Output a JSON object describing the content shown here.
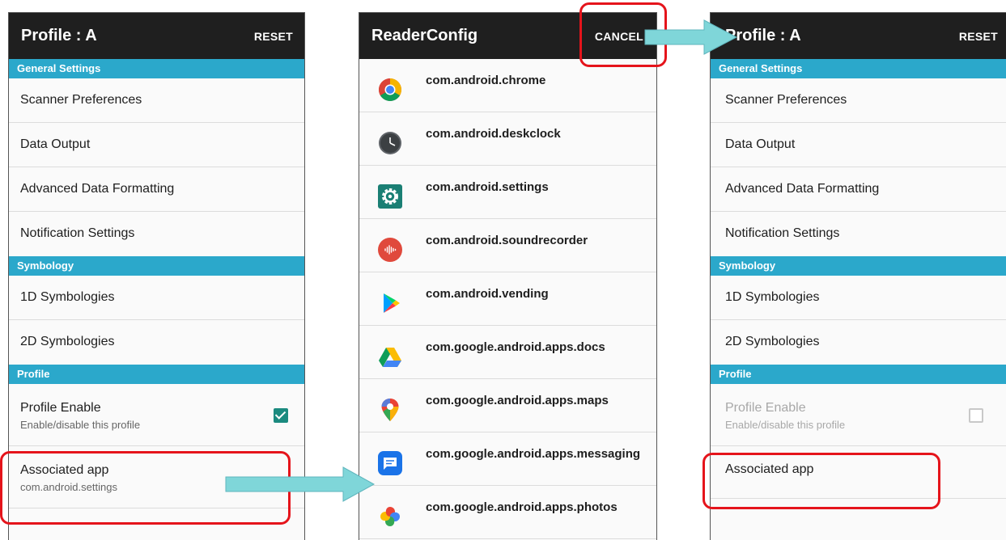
{
  "screen_left": {
    "title": "Profile : A",
    "action": "RESET",
    "sections": {
      "general": "General Settings",
      "symbology": "Symbology",
      "profile": "Profile"
    },
    "items": {
      "scanner_preferences": "Scanner Preferences",
      "data_output": "Data Output",
      "advanced_data_formatting": "Advanced Data Formatting",
      "notification_settings": "Notification Settings",
      "sym_1d": "1D Symbologies",
      "sym_2d": "2D Symbologies",
      "profile_enable": "Profile Enable",
      "profile_enable_sub": "Enable/disable this profile",
      "associated_app": "Associated app",
      "associated_app_sub": "com.android.settings"
    },
    "profile_enabled": true
  },
  "screen_middle": {
    "title": "ReaderConfig",
    "action": "CANCEL",
    "apps": [
      {
        "name": "com.android.chrome",
        "icon": "chrome-icon"
      },
      {
        "name": "com.android.deskclock",
        "icon": "clock-icon"
      },
      {
        "name": "com.android.settings",
        "icon": "settings-gear-icon"
      },
      {
        "name": "com.android.soundrecorder",
        "icon": "sound-recorder-icon"
      },
      {
        "name": "com.android.vending",
        "icon": "play-store-icon"
      },
      {
        "name": "com.google.android.apps.docs",
        "icon": "drive-icon"
      },
      {
        "name": "com.google.android.apps.maps",
        "icon": "maps-pin-icon"
      },
      {
        "name": "com.google.android.apps.messaging",
        "icon": "messages-icon"
      },
      {
        "name": "com.google.android.apps.photos",
        "icon": "photos-pinwheel-icon"
      }
    ]
  },
  "screen_right": {
    "title": "Profile : A",
    "action": "RESET",
    "sections": {
      "general": "General Settings",
      "symbology": "Symbology",
      "profile": "Profile"
    },
    "items": {
      "scanner_preferences": "Scanner Preferences",
      "data_output": "Data Output",
      "advanced_data_formatting": "Advanced Data Formatting",
      "notification_settings": "Notification Settings",
      "sym_1d": "1D Symbologies",
      "sym_2d": "2D Symbologies",
      "profile_enable": "Profile Enable",
      "profile_enable_sub": "Enable/disable this profile",
      "associated_app": "Associated app"
    },
    "profile_enabled": false
  },
  "colors": {
    "titlebar": "#1f1f1f",
    "section": "#2ba8cb",
    "highlight": "#e5141b",
    "arrow": "#7fd6d9",
    "checkbox": "#1b8a7f"
  }
}
